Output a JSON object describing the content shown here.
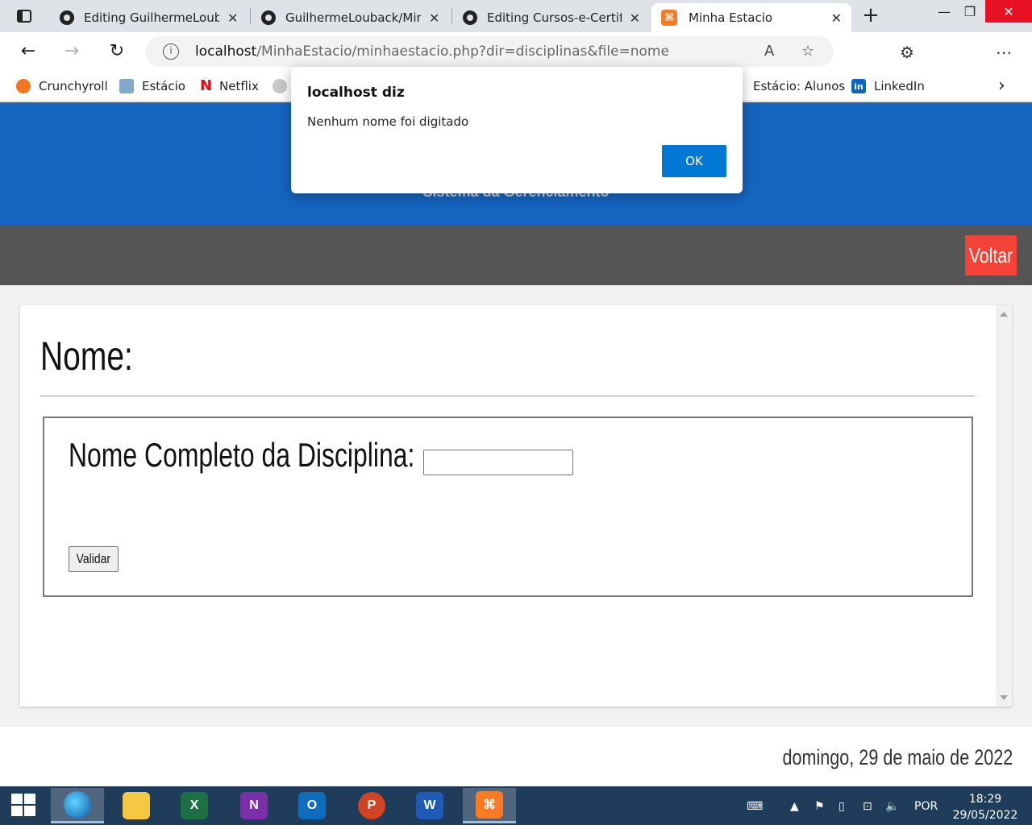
{
  "browser": {
    "tabs": [
      {
        "title": "Editing GuilhermeLoubac",
        "icon": "github-icon"
      },
      {
        "title": "GuilhermeLouback/Minha",
        "icon": "github-icon"
      },
      {
        "title": "Editing Cursos-e-Certifica",
        "icon": "github-icon"
      },
      {
        "title": "Minha Estacio",
        "icon": "xampp-icon",
        "active": true
      }
    ],
    "address": {
      "host": "localhost",
      "path": "/MinhaEstacio/minhaestacio.php?dir=disciplinas&file=nome"
    },
    "favorites": [
      {
        "label": "Crunchyroll",
        "icon": "crunchyroll-icon"
      },
      {
        "label": "Estácio",
        "icon": "estacio-icon"
      },
      {
        "label": "Netflix",
        "icon": "netflix-icon"
      },
      {
        "label": "Estácio: Alunos",
        "icon": "estacio-alunos-icon"
      },
      {
        "label": "LinkedIn",
        "icon": "linkedin-icon"
      }
    ]
  },
  "dialog": {
    "title": "localhost diz",
    "message": "Nenhum nome foi digitado",
    "ok_label": "OK"
  },
  "page": {
    "subtitle": "Sistema da Gerenciamento",
    "back_label": "Voltar",
    "heading": "Nome:",
    "form": {
      "field_label": "Nome Completo da Disciplina:",
      "field_value": "",
      "submit_label": "Validar"
    },
    "footer_date": "domingo, 29 de maio de 2022",
    "colors": {
      "header": "#1565c0",
      "nav": "#555555",
      "back_button": "#f44336",
      "dialog_ok": "#0078d4"
    }
  },
  "taskbar": {
    "apps": [
      {
        "name": "Microsoft Edge",
        "icon": "edge-icon",
        "active": true
      },
      {
        "name": "File Explorer",
        "icon": "file-explorer-icon",
        "active": false
      },
      {
        "name": "Excel",
        "icon": "excel-icon",
        "letter": "X",
        "active": false
      },
      {
        "name": "OneNote",
        "icon": "onenote-icon",
        "letter": "N",
        "active": false
      },
      {
        "name": "Outlook",
        "icon": "outlook-icon",
        "letter": "O",
        "active": false
      },
      {
        "name": "PowerPoint",
        "icon": "powerpoint-icon",
        "letter": "P",
        "active": false
      },
      {
        "name": "Word",
        "icon": "word-icon",
        "letter": "W",
        "active": false
      },
      {
        "name": "XAMPP",
        "icon": "xampp-icon",
        "active": true
      }
    ],
    "language": "POR",
    "time": "18:29",
    "date": "29/05/2022"
  }
}
